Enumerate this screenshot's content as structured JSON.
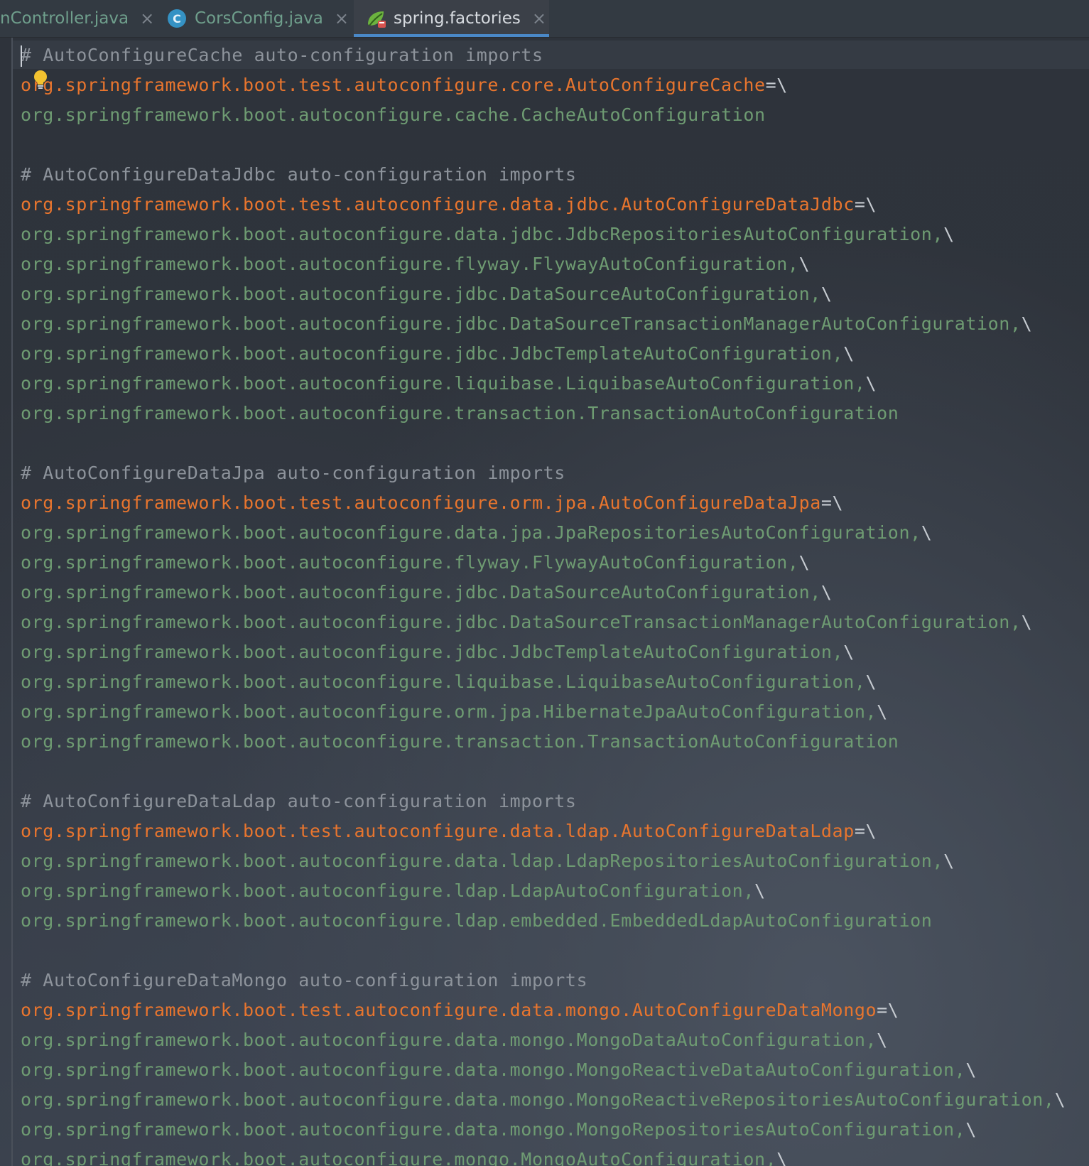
{
  "tabs": [
    {
      "label": "nController.java",
      "close": "×"
    },
    {
      "label": "CorsConfig.java",
      "badge": "C",
      "close": "×"
    },
    {
      "label": "spring.factories",
      "icon": "spring-leaf-icon",
      "close": "×",
      "active": true
    }
  ],
  "colors": {
    "comment": "#8d939b",
    "key": "#e8752e",
    "value": "#6e9b72",
    "accent": "#4a88c7"
  },
  "lines": [
    {
      "type": "comment",
      "text": "# AutoConfigureCache auto-configuration imports"
    },
    {
      "type": "key",
      "text": "org.springframework.boot.test.autoconfigure.core.AutoConfigureCache",
      "sep": "=\\"
    },
    {
      "type": "val",
      "text": "org.springframework.boot.autoconfigure.cache.CacheAutoConfiguration",
      "sep": ""
    },
    {
      "type": "blank",
      "text": ""
    },
    {
      "type": "comment",
      "text": "# AutoConfigureDataJdbc auto-configuration imports"
    },
    {
      "type": "key",
      "text": "org.springframework.boot.test.autoconfigure.data.jdbc.AutoConfigureDataJdbc",
      "sep": "=\\"
    },
    {
      "type": "val",
      "text": "org.springframework.boot.autoconfigure.data.jdbc.JdbcRepositoriesAutoConfiguration,",
      "sep": "\\"
    },
    {
      "type": "val",
      "text": "org.springframework.boot.autoconfigure.flyway.FlywayAutoConfiguration,",
      "sep": "\\"
    },
    {
      "type": "val",
      "text": "org.springframework.boot.autoconfigure.jdbc.DataSourceAutoConfiguration,",
      "sep": "\\"
    },
    {
      "type": "val",
      "text": "org.springframework.boot.autoconfigure.jdbc.DataSourceTransactionManagerAutoConfiguration,",
      "sep": "\\"
    },
    {
      "type": "val",
      "text": "org.springframework.boot.autoconfigure.jdbc.JdbcTemplateAutoConfiguration,",
      "sep": "\\"
    },
    {
      "type": "val",
      "text": "org.springframework.boot.autoconfigure.liquibase.LiquibaseAutoConfiguration,",
      "sep": "\\"
    },
    {
      "type": "val",
      "text": "org.springframework.boot.autoconfigure.transaction.TransactionAutoConfiguration",
      "sep": ""
    },
    {
      "type": "blank",
      "text": ""
    },
    {
      "type": "comment",
      "text": "# AutoConfigureDataJpa auto-configuration imports"
    },
    {
      "type": "key",
      "text": "org.springframework.boot.test.autoconfigure.orm.jpa.AutoConfigureDataJpa",
      "sep": "=\\"
    },
    {
      "type": "val",
      "text": "org.springframework.boot.autoconfigure.data.jpa.JpaRepositoriesAutoConfiguration,",
      "sep": "\\"
    },
    {
      "type": "val",
      "text": "org.springframework.boot.autoconfigure.flyway.FlywayAutoConfiguration,",
      "sep": "\\"
    },
    {
      "type": "val",
      "text": "org.springframework.boot.autoconfigure.jdbc.DataSourceAutoConfiguration,",
      "sep": "\\"
    },
    {
      "type": "val",
      "text": "org.springframework.boot.autoconfigure.jdbc.DataSourceTransactionManagerAutoConfiguration,",
      "sep": "\\"
    },
    {
      "type": "val",
      "text": "org.springframework.boot.autoconfigure.jdbc.JdbcTemplateAutoConfiguration,",
      "sep": "\\"
    },
    {
      "type": "val",
      "text": "org.springframework.boot.autoconfigure.liquibase.LiquibaseAutoConfiguration,",
      "sep": "\\"
    },
    {
      "type": "val",
      "text": "org.springframework.boot.autoconfigure.orm.jpa.HibernateJpaAutoConfiguration,",
      "sep": "\\"
    },
    {
      "type": "val",
      "text": "org.springframework.boot.autoconfigure.transaction.TransactionAutoConfiguration",
      "sep": ""
    },
    {
      "type": "blank",
      "text": ""
    },
    {
      "type": "comment",
      "text": "# AutoConfigureDataLdap auto-configuration imports"
    },
    {
      "type": "key",
      "text": "org.springframework.boot.test.autoconfigure.data.ldap.AutoConfigureDataLdap",
      "sep": "=\\"
    },
    {
      "type": "val",
      "text": "org.springframework.boot.autoconfigure.data.ldap.LdapRepositoriesAutoConfiguration,",
      "sep": "\\"
    },
    {
      "type": "val",
      "text": "org.springframework.boot.autoconfigure.ldap.LdapAutoConfiguration,",
      "sep": "\\"
    },
    {
      "type": "val",
      "text": "org.springframework.boot.autoconfigure.ldap.embedded.EmbeddedLdapAutoConfiguration",
      "sep": ""
    },
    {
      "type": "blank",
      "text": ""
    },
    {
      "type": "comment",
      "text": "# AutoConfigureDataMongo auto-configuration imports"
    },
    {
      "type": "key",
      "text": "org.springframework.boot.test.autoconfigure.data.mongo.AutoConfigureDataMongo",
      "sep": "=\\"
    },
    {
      "type": "val",
      "text": "org.springframework.boot.autoconfigure.data.mongo.MongoDataAutoConfiguration,",
      "sep": "\\"
    },
    {
      "type": "val",
      "text": "org.springframework.boot.autoconfigure.data.mongo.MongoReactiveDataAutoConfiguration,",
      "sep": "\\"
    },
    {
      "type": "val",
      "text": "org.springframework.boot.autoconfigure.data.mongo.MongoReactiveRepositoriesAutoConfiguration,",
      "sep": "\\"
    },
    {
      "type": "val",
      "text": "org.springframework.boot.autoconfigure.data.mongo.MongoRepositoriesAutoConfiguration,",
      "sep": "\\"
    },
    {
      "type": "val",
      "text": "org.springframework.boot.autoconfigure.mongo.MongoAutoConfiguration,",
      "sep": "\\"
    }
  ]
}
